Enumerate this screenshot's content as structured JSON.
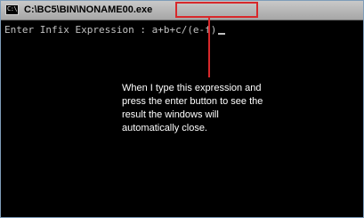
{
  "window": {
    "title": "C:\\BC5\\BIN\\NONAME00.exe",
    "icon": "console-icon",
    "icon_glyph": "C:\\"
  },
  "console": {
    "prompt": "Enter Infix Expression : ",
    "input": "a+b+c/(e-f)"
  },
  "annotation": {
    "lines": [
      "When I type this expression and",
      "press the enter button to see the",
      "result the windows will",
      "automatically close."
    ],
    "color": "#d7282b"
  }
}
